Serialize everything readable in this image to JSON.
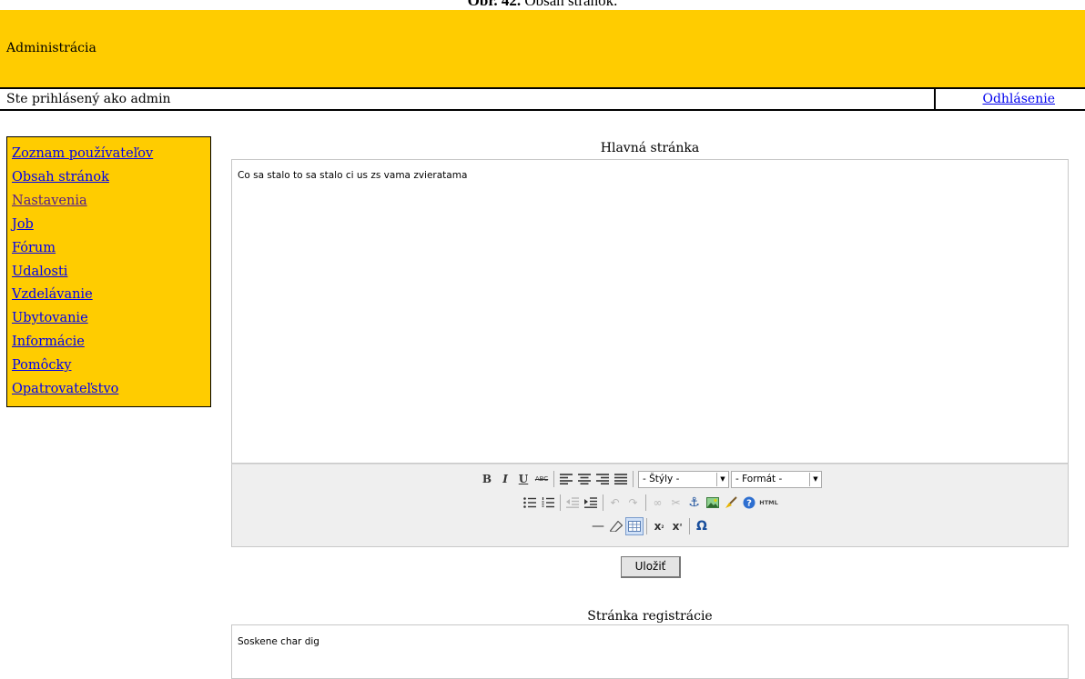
{
  "figure_caption": {
    "label": "Obr. 42.",
    "text": "Obsah stránok."
  },
  "header": {
    "title": "Administrácia"
  },
  "userbar": {
    "logged_in_text": "Ste prihlásený ako admin",
    "logout_label": "Odhlásenie"
  },
  "menu": {
    "items": [
      {
        "label": "Zoznam používateľov"
      },
      {
        "label": "Obsah stránok"
      },
      {
        "label": "Nastavenia"
      },
      {
        "label": "Job"
      },
      {
        "label": "Fórum"
      },
      {
        "label": "Udalosti"
      },
      {
        "label": "Vzdelávanie"
      },
      {
        "label": "Ubytovanie"
      },
      {
        "label": "Informácie"
      },
      {
        "label": "Pomôcky"
      },
      {
        "label": "Opatrovateľstvo"
      }
    ]
  },
  "sections": [
    {
      "title": "Hlavná stránka",
      "content": "Co sa stalo to sa stalo ci us zs vama zvieratama"
    },
    {
      "title": "Stránka registrácie",
      "content": "Soskene char dig"
    }
  ],
  "toolbar": {
    "styles_label": "- Štýly -",
    "format_label": "- Formát -",
    "html_label": "HTML"
  },
  "save_label": "Uložiť",
  "colors": {
    "header_bg": "#ffcc00",
    "link": "#0000ee",
    "visited_link": "#551a8b"
  }
}
